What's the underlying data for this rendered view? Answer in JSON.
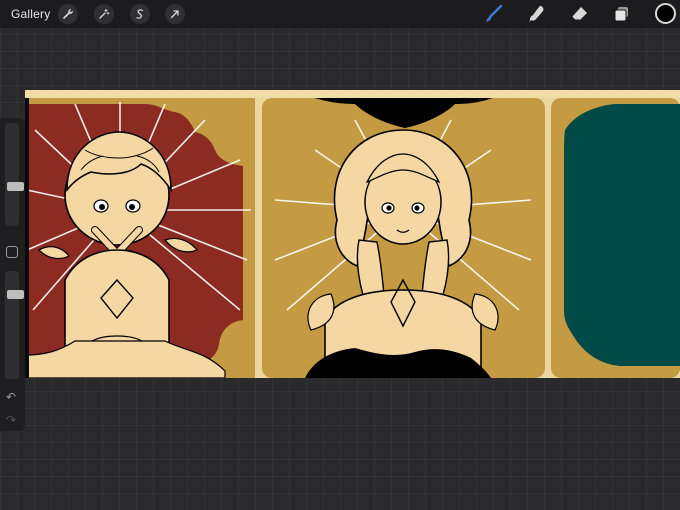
{
  "toolbar": {
    "gallery_label": "Gallery",
    "left_tools": [
      {
        "name": "wrench-icon"
      },
      {
        "name": "magic-wand-icon"
      },
      {
        "name": "selection-icon"
      },
      {
        "name": "transform-arrow-icon"
      }
    ],
    "right_tools": [
      {
        "name": "brush-icon",
        "active": true
      },
      {
        "name": "smudge-icon"
      },
      {
        "name": "eraser-icon"
      },
      {
        "name": "layers-icon"
      }
    ],
    "current_color": "#000000",
    "accent_color": "#3a7bd5"
  },
  "sidebar": {
    "brush_size": 0.45,
    "brush_opacity": 0.7,
    "undo_icon": "undo-icon",
    "redo_icon": "redo-icon"
  },
  "canvas_colors": {
    "background": "#ebd7a0",
    "red_panel": "#8b2b22",
    "gold_panel": "#c49a42",
    "teal_panel": "#004a47",
    "skin": "#f5d7a3",
    "line": "#000000"
  }
}
